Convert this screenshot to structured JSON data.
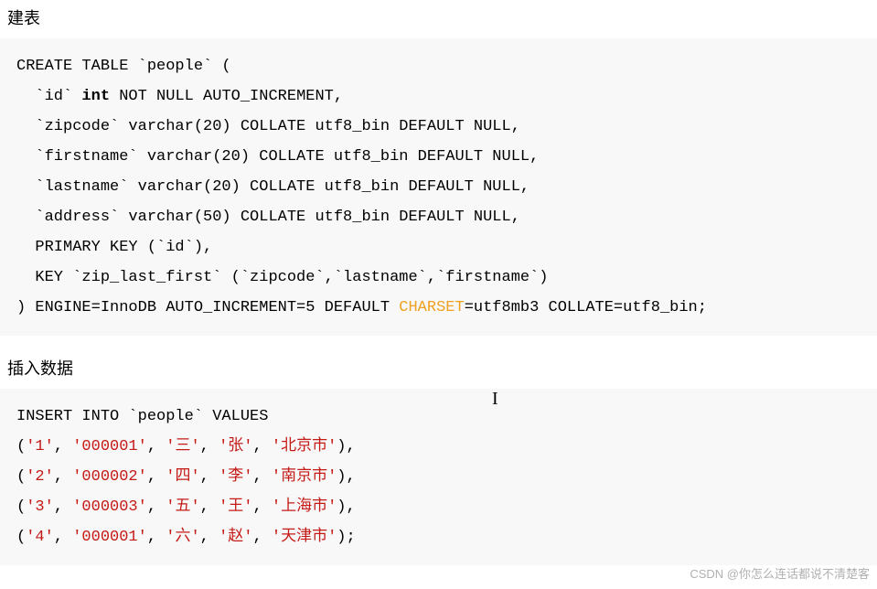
{
  "heading_create": "建表",
  "heading_insert": "插入数据",
  "create_sql": {
    "line1_a": "CREATE TABLE `people` (",
    "line2_a": "  `id` ",
    "line2_kw": "int",
    "line2_b": " NOT NULL AUTO_INCREMENT,",
    "line3": "  `zipcode` varchar(20) COLLATE utf8_bin DEFAULT NULL,",
    "line4": "  `firstname` varchar(20) COLLATE utf8_bin DEFAULT NULL,",
    "line5": "  `lastname` varchar(20) COLLATE utf8_bin DEFAULT NULL,",
    "line6": "  `address` varchar(50) COLLATE utf8_bin DEFAULT NULL,",
    "line7": "  PRIMARY KEY (`id`),",
    "line8": "  KEY `zip_last_first` (`zipcode`,`lastname`,`firstname`)",
    "line9_a": ") ENGINE=InnoDB AUTO_INCREMENT=5 DEFAULT ",
    "line9_hl": "CHARSET",
    "line9_b": "=utf8mb3 COLLATE=utf8_bin;"
  },
  "insert_sql": {
    "line1": "INSERT INTO `people` VALUES",
    "rows": [
      {
        "open": "(",
        "v1": "'1'",
        "v2": "'000001'",
        "v3": "'三'",
        "v4": "'张'",
        "v5": "'北京市'",
        "close": "),"
      },
      {
        "open": "(",
        "v1": "'2'",
        "v2": "'000002'",
        "v3": "'四'",
        "v4": "'李'",
        "v5": "'南京市'",
        "close": "),"
      },
      {
        "open": "(",
        "v1": "'3'",
        "v2": "'000003'",
        "v3": "'五'",
        "v4": "'王'",
        "v5": "'上海市'",
        "close": "),"
      },
      {
        "open": "(",
        "v1": "'4'",
        "v2": "'000001'",
        "v3": "'六'",
        "v4": "'赵'",
        "v5": "'天津市'",
        "close": ");"
      }
    ]
  },
  "sep": ", ",
  "watermark": "CSDN @你怎么连话都说不清楚客"
}
